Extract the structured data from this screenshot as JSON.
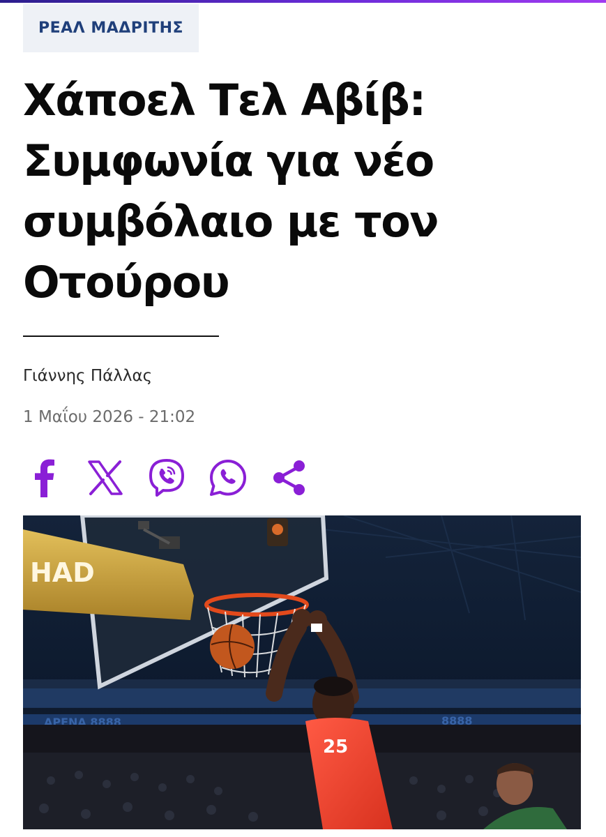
{
  "colors": {
    "accent": "#8a1fd6",
    "category_bg": "#eef1f6",
    "category_text": "#1f3f7a",
    "headline": "#0a0a0a",
    "meta": "#6b6b6b"
  },
  "category": {
    "label": "ΡΕΑΛ ΜΑΔΡΙΤΗΣ"
  },
  "article": {
    "title_lines": [
      "Χάποελ Τελ Αβίβ:",
      "Συμφωνία για νέο",
      "συμβόλαιο με τον",
      "Οτούρου"
    ],
    "author": "Γιάννης Πάλλας",
    "date": "1 Μαΐου 2026 - 21:02"
  },
  "share": [
    {
      "icon": "facebook-icon"
    },
    {
      "icon": "x-icon"
    },
    {
      "icon": "viber-icon"
    },
    {
      "icon": "whatsapp-icon"
    },
    {
      "icon": "share-icon"
    }
  ],
  "hero_image": {
    "subject": "basketball-dunk-photo",
    "banner_text": "HAD",
    "arena_text": "ΑΡΕΝΑ 8888",
    "jersey_number": "25"
  }
}
